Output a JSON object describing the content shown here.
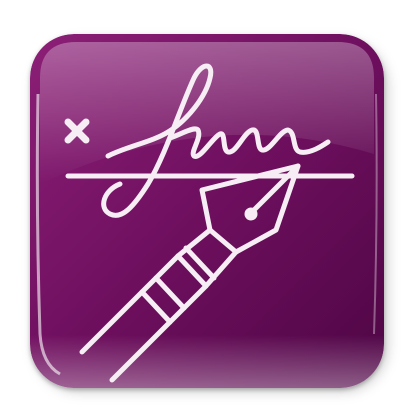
{
  "icon": {
    "name": "signature-pen-app-icon",
    "colors": {
      "background_top": "#8c1f77",
      "background_mid": "#6e0f5e",
      "background_bottom": "#4e0645",
      "glyph": "#f6eef4",
      "gloss": "#ffffff"
    }
  }
}
